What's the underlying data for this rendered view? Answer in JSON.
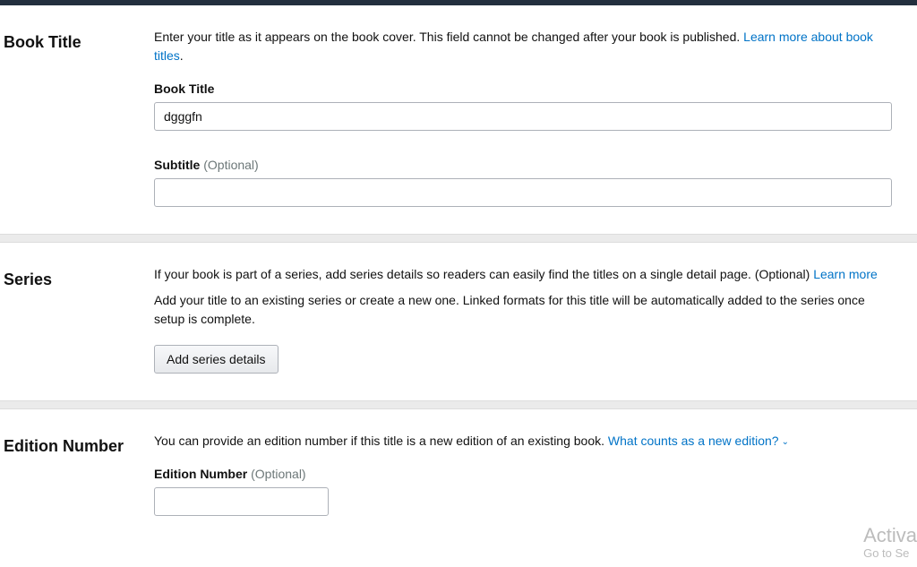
{
  "sections": {
    "bookTitle": {
      "heading": "Book Title",
      "description": "Enter your title as it appears on the book cover. This field cannot be changed after your book is published. ",
      "descriptionLink": "Learn more about book titles",
      "descriptionSuffix": ".",
      "fields": {
        "title": {
          "label": "Book Title",
          "value": "dgggfn"
        },
        "subtitle": {
          "label": "Subtitle ",
          "optional": "(Optional)",
          "value": ""
        }
      }
    },
    "series": {
      "heading": "Series",
      "description1a": "If your book is part of a series, add series details so readers can easily find the titles on a single detail page. (Optional) ",
      "description1Link": "Learn more",
      "description2": "Add your title to an existing series or create a new one. Linked formats for this title will be automatically added to the series once setup is complete.",
      "buttonLabel": "Add series details"
    },
    "editionNumber": {
      "heading": "Edition Number",
      "description": "You can provide an edition number if this title is a new edition of an existing book. ",
      "descriptionLink": "What counts as a new edition?",
      "field": {
        "label": "Edition Number ",
        "optional": "(Optional)",
        "value": ""
      }
    }
  },
  "watermark": {
    "line1": "Activa",
    "line2": "Go to Se"
  }
}
